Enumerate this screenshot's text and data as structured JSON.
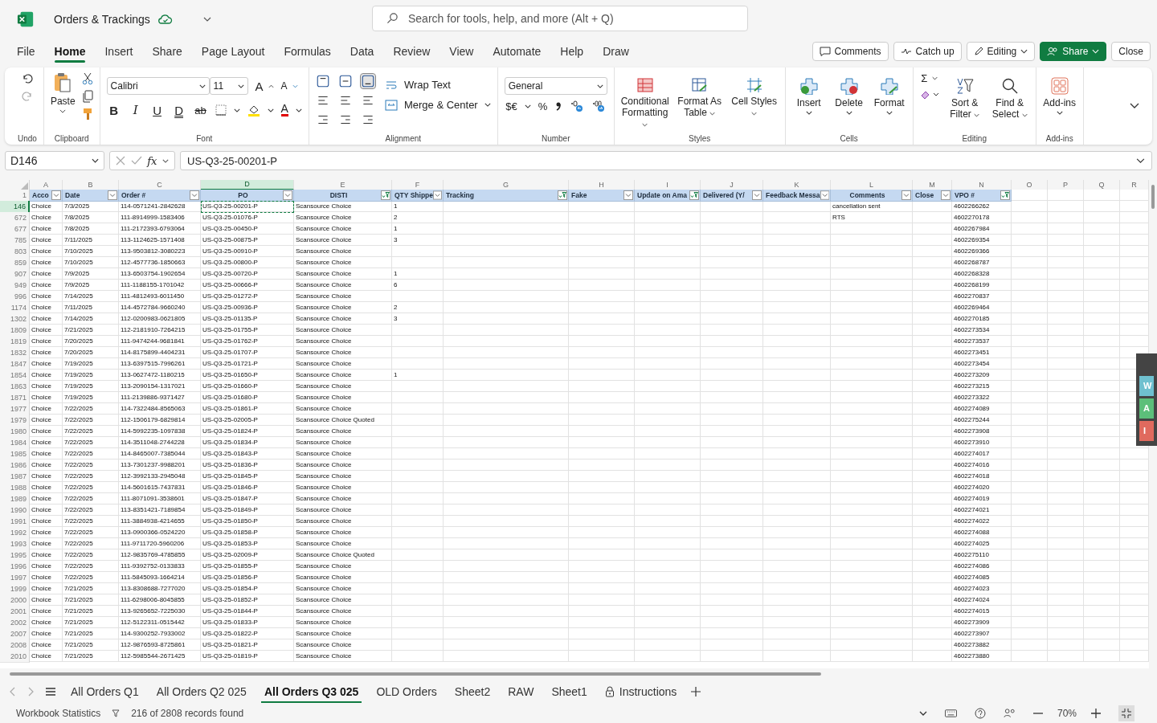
{
  "title_bar": {
    "title": "Orders & Trackings",
    "search": {
      "placeholder": "Search for tools, help, and more (Alt + Q)"
    }
  },
  "menu": [
    {
      "label": "File",
      "selected": false
    },
    {
      "label": "Home",
      "selected": true
    },
    {
      "label": "Insert",
      "selected": false
    },
    {
      "label": "Share",
      "selected": false
    },
    {
      "label": "Page Layout",
      "selected": false
    },
    {
      "label": "Formulas",
      "selected": false
    },
    {
      "label": "Data",
      "selected": false
    },
    {
      "label": "Review",
      "selected": false
    },
    {
      "label": "View",
      "selected": false
    },
    {
      "label": "Automate",
      "selected": false
    },
    {
      "label": "Help",
      "selected": false
    },
    {
      "label": "Draw",
      "selected": false
    }
  ],
  "actions": {
    "comments": "Comments",
    "catch_up": "Catch up",
    "editing": "Editing",
    "share": "Share",
    "close": "Close"
  },
  "ribbon": {
    "undo": {
      "label": "Undo"
    },
    "clipboard": {
      "paste": "Paste",
      "label": "Clipboard"
    },
    "font": {
      "name": "Calibri",
      "size": "11",
      "size_buttons": [
        "A",
        "A"
      ],
      "format_buttons": [
        "B",
        "I",
        "U",
        "D",
        "ab"
      ],
      "color_button": "A",
      "label": "Font"
    },
    "alignment": {
      "wrap": "Wrap Text",
      "merge": "Merge & Center",
      "label": "Alignment"
    },
    "number": {
      "format": "General",
      "currency": "$€",
      "percent": "%",
      "label": "Number"
    },
    "styles": {
      "buttons": [
        "Conditional Formatting",
        "Format As Table",
        "Cell Styles"
      ],
      "label": "Styles"
    },
    "cells": {
      "buttons": [
        "Insert",
        "Delete",
        "Format"
      ],
      "label": "Cells"
    },
    "editing": {
      "sum": "Σ",
      "buttons": [
        "Sort & Filter",
        "Find & Select"
      ],
      "label": "Editing"
    },
    "addins": {
      "buttons": [
        "Add-ins"
      ],
      "label": "Add-ins"
    }
  },
  "formula_bar": {
    "name_box": "D146",
    "fx": "fx",
    "formula": "US-Q3-25-00201-P"
  },
  "table": {
    "header_row": "1",
    "columns": [
      {
        "letter": "A",
        "header": "Acco",
        "filtered": false,
        "selected": false
      },
      {
        "letter": "B",
        "header": "Date",
        "filtered": false,
        "selected": false
      },
      {
        "letter": "C",
        "header": "Order #",
        "filtered": false,
        "selected": false
      },
      {
        "letter": "D",
        "header": "PO",
        "filtered": false,
        "selected": true
      },
      {
        "letter": "E",
        "header": "DISTI",
        "filtered": true,
        "selected": false
      },
      {
        "letter": "F",
        "header": "QTY Shippe",
        "filtered": false,
        "selected": false
      },
      {
        "letter": "G",
        "header": "Tracking",
        "filtered": true,
        "selected": false
      },
      {
        "letter": "H",
        "header": "Fake",
        "filtered": false,
        "selected": false
      },
      {
        "letter": "I",
        "header": "Update on Ama",
        "filtered": true,
        "selected": false
      },
      {
        "letter": "J",
        "header": "Delivered (Y/",
        "filtered": false,
        "selected": false
      },
      {
        "letter": "K",
        "header": "Feedback Messa",
        "filtered": false,
        "selected": false
      },
      {
        "letter": "L",
        "header": "Comments",
        "filtered": false,
        "selected": false
      },
      {
        "letter": "M",
        "header": "Close",
        "filtered": false,
        "selected": false
      },
      {
        "letter": "N",
        "header": "VPO #",
        "filtered": true,
        "selected": false
      },
      {
        "letter": "O",
        "selected": false
      },
      {
        "letter": "P",
        "selected": false
      },
      {
        "letter": "Q",
        "selected": false
      },
      {
        "letter": "R",
        "selected": false
      }
    ],
    "rows": [
      {
        "row": "146",
        "account": "Choice",
        "date": "7/3/2025",
        "order": "114-0571241-2842628",
        "po": "US-Q3-25-00201-P",
        "disti": "Scansource Choice",
        "qty": "1",
        "comments": "cancellation sent",
        "vpo": "4602266262",
        "selected": true
      },
      {
        "row": "672",
        "account": "Choice",
        "date": "7/8/2025",
        "order": "111-8914999-1583406",
        "po": "US-Q3-25-01076-P",
        "disti": "Scansource Choice",
        "qty": "2",
        "comments": "RTS",
        "vpo": "4602270178",
        "selected": false
      },
      {
        "row": "677",
        "account": "Choice",
        "date": "7/8/2025",
        "order": "111-2172393-6793064",
        "po": "US-Q3-25-00450-P",
        "disti": "Scansource Choice",
        "qty": "1",
        "vpo": "4602267984",
        "selected": false
      },
      {
        "row": "785",
        "account": "Choice",
        "date": "7/11/2025",
        "order": "113-1124625-1571408",
        "po": "US-Q3-25-00875-P",
        "disti": "Scansource Choice",
        "qty": "3",
        "vpo": "4602269354",
        "selected": false
      },
      {
        "row": "803",
        "account": "Choice",
        "date": "7/10/2025",
        "order": "113-9503812-3080223",
        "po": "US-Q3-25-00910-P",
        "disti": "Scansource Choice",
        "vpo": "4602269366",
        "selected": false
      },
      {
        "row": "859",
        "account": "Choice",
        "date": "7/10/2025",
        "order": "112-4577736-1850663",
        "po": "US-Q3-25-00800-P",
        "disti": "Scansource Choice",
        "vpo": "4602268787",
        "selected": false
      },
      {
        "row": "907",
        "account": "Choice",
        "date": "7/9/2025",
        "order": "113-6503754-1902654",
        "po": "US-Q3-25-00720-P",
        "disti": "Scansource Choice",
        "qty": "1",
        "vpo": "4602268328",
        "selected": false
      },
      {
        "row": "949",
        "account": "Choice",
        "date": "7/9/2025",
        "order": "111-1188155-1701042",
        "po": "US-Q3-25-00666-P",
        "disti": "Scansource Choice",
        "qty": "6",
        "vpo": "4602268199",
        "selected": false
      },
      {
        "row": "996",
        "account": "Choice",
        "date": "7/14/2025",
        "order": "111-4812493-6011450",
        "po": "US-Q3-25-01272-P",
        "disti": "Scansource Choice",
        "vpo": "4602270837",
        "selected": false
      },
      {
        "row": "1174",
        "account": "Choice",
        "date": "7/11/2025",
        "order": "114-4572784-9660240",
        "po": "US-Q3-25-00936-P",
        "disti": "Scansource Choice",
        "qty": "2",
        "vpo": "4602269464",
        "selected": false
      },
      {
        "row": "1302",
        "account": "Choice",
        "date": "7/14/2025",
        "order": "112-0200983-0621805",
        "po": "US-Q3-25-01135-P",
        "disti": "Scansource Choice",
        "qty": "3",
        "vpo": "4602270185",
        "selected": false
      },
      {
        "row": "1809",
        "account": "Choice",
        "date": "7/21/2025",
        "order": "112-2181910-7264215",
        "po": "US-Q3-25-01755-P",
        "disti": "Scansource Choice",
        "vpo": "4602273534",
        "selected": false
      },
      {
        "row": "1819",
        "account": "Choice",
        "date": "7/20/2025",
        "order": "111-9474244-9681841",
        "po": "US-Q3-25-01762-P",
        "disti": "Scansource Choice",
        "vpo": "4602273537",
        "selected": false
      },
      {
        "row": "1832",
        "account": "Choice",
        "date": "7/20/2025",
        "order": "114-8175899-4404231",
        "po": "US-Q3-25-01707-P",
        "disti": "Scansource Choice",
        "vpo": "4602273451",
        "selected": false
      },
      {
        "row": "1847",
        "account": "Choice",
        "date": "7/19/2025",
        "order": "113-6397515-7996261",
        "po": "US-Q3-25-01721-P",
        "disti": "Scansource Choice",
        "vpo": "4602273454",
        "selected": false
      },
      {
        "row": "1854",
        "account": "Choice",
        "date": "7/19/2025",
        "order": "113-0627472-1180215",
        "po": "US-Q3-25-01650-P",
        "disti": "Scansource Choice",
        "qty": "1",
        "vpo": "4602273209",
        "selected": false
      },
      {
        "row": "1863",
        "account": "Choice",
        "date": "7/19/2025",
        "order": "113-2090154-1317021",
        "po": "US-Q3-25-01660-P",
        "disti": "Scansource Choice",
        "vpo": "4602273215",
        "selected": false
      },
      {
        "row": "1871",
        "account": "Choice",
        "date": "7/19/2025",
        "order": "111-2139886-9371427",
        "po": "US-Q3-25-01680-P",
        "disti": "Scansource Choice",
        "vpo": "4602273322",
        "selected": false
      },
      {
        "row": "1977",
        "account": "Choice",
        "date": "7/22/2025",
        "order": "114-7322484-8565063",
        "po": "US-Q3-25-01861-P",
        "disti": "Scansource Choice",
        "vpo": "4602274089",
        "selected": false
      },
      {
        "row": "1979",
        "account": "Choice",
        "date": "7/22/2025",
        "order": "112-1506179-6829814",
        "po": "US-Q3-25-02005-P",
        "disti": "Scansource Choice Quoted",
        "vpo": "4602275244",
        "selected": false
      },
      {
        "row": "1980",
        "account": "Choice",
        "date": "7/22/2025",
        "order": "114-5992235-1097838",
        "po": "US-Q3-25-01824-P",
        "disti": "Scansource Choice",
        "vpo": "4602273908",
        "selected": false
      },
      {
        "row": "1984",
        "account": "Choice",
        "date": "7/22/2025",
        "order": "114-3511048-2744228",
        "po": "US-Q3-25-01834-P",
        "disti": "Scansource Choice",
        "vpo": "4602273910",
        "selected": false
      },
      {
        "row": "1985",
        "account": "Choice",
        "date": "7/22/2025",
        "order": "114-8465007-7385044",
        "po": "US-Q3-25-01843-P",
        "disti": "Scansource Choice",
        "vpo": "4602274017",
        "selected": false
      },
      {
        "row": "1986",
        "account": "Choice",
        "date": "7/22/2025",
        "order": "113-7301237-9988201",
        "po": "US-Q3-25-01836-P",
        "disti": "Scansource Choice",
        "vpo": "4602274016",
        "selected": false
      },
      {
        "row": "1987",
        "account": "Choice",
        "date": "7/22/2025",
        "order": "112-3992133-2945048",
        "po": "US-Q3-25-01845-P",
        "disti": "Scansource Choice",
        "vpo": "4602274018",
        "selected": false
      },
      {
        "row": "1988",
        "account": "Choice",
        "date": "7/22/2025",
        "order": "114-5601615-7437831",
        "po": "US-Q3-25-01846-P",
        "disti": "Scansource Choice",
        "vpo": "4602274020",
        "selected": false
      },
      {
        "row": "1989",
        "account": "Choice",
        "date": "7/22/2025",
        "order": "111-8071091-3538601",
        "po": "US-Q3-25-01847-P",
        "disti": "Scansource Choice",
        "vpo": "4602274019",
        "selected": false
      },
      {
        "row": "1990",
        "account": "Choice",
        "date": "7/22/2025",
        "order": "113-8351421-7189854",
        "po": "US-Q3-25-01849-P",
        "disti": "Scansource Choice",
        "vpo": "4602274021",
        "selected": false
      },
      {
        "row": "1991",
        "account": "Choice",
        "date": "7/22/2025",
        "order": "111-3884938-4214655",
        "po": "US-Q3-25-01850-P",
        "disti": "Scansource Choice",
        "vpo": "4602274022",
        "selected": false
      },
      {
        "row": "1992",
        "account": "Choice",
        "date": "7/22/2025",
        "order": "113-0900366-0524220",
        "po": "US-Q3-25-01858-P",
        "disti": "Scansource Choice",
        "vpo": "4602274088",
        "selected": false
      },
      {
        "row": "1993",
        "account": "Choice",
        "date": "7/22/2025",
        "order": "111-9711720-5960206",
        "po": "US-Q3-25-01853-P",
        "disti": "Scansource Choice",
        "vpo": "4602274025",
        "selected": false
      },
      {
        "row": "1995",
        "account": "Choice",
        "date": "7/22/2025",
        "order": "112-9835769-4785855",
        "po": "US-Q3-25-02009-P",
        "disti": "Scansource Choice Quoted",
        "vpo": "4602275110",
        "selected": false
      },
      {
        "row": "1996",
        "account": "Choice",
        "date": "7/22/2025",
        "order": "111-9392752-0133833",
        "po": "US-Q3-25-01855-P",
        "disti": "Scansource Choice",
        "vpo": "4602274086",
        "selected": false
      },
      {
        "row": "1997",
        "account": "Choice",
        "date": "7/22/2025",
        "order": "111-5845093-1664214",
        "po": "US-Q3-25-01856-P",
        "disti": "Scansource Choice",
        "vpo": "4602274085",
        "selected": false
      },
      {
        "row": "1999",
        "account": "Choice",
        "date": "7/21/2025",
        "order": "113-8308688-7277020",
        "po": "US-Q3-25-01854-P",
        "disti": "Scansource Choice",
        "vpo": "4602274023",
        "selected": false
      },
      {
        "row": "2000",
        "account": "Choice",
        "date": "7/21/2025",
        "order": "111-6298006-8045855",
        "po": "US-Q3-25-01852-P",
        "disti": "Scansource Choice",
        "vpo": "4602274024",
        "selected": false
      },
      {
        "row": "2001",
        "account": "Choice",
        "date": "7/21/2025",
        "order": "113-9265652-7225030",
        "po": "US-Q3-25-01844-P",
        "disti": "Scansource Choice",
        "vpo": "4602274015",
        "selected": false
      },
      {
        "row": "2002",
        "account": "Choice",
        "date": "7/21/2025",
        "order": "112-5122311-0515442",
        "po": "US-Q3-25-01833-P",
        "disti": "Scansource Choice",
        "vpo": "4602273909",
        "selected": false
      },
      {
        "row": "2007",
        "account": "Choice",
        "date": "7/21/2025",
        "order": "114-9300252-7933002",
        "po": "US-Q3-25-01822-P",
        "disti": "Scansource Choice",
        "vpo": "4602273907",
        "selected": false
      },
      {
        "row": "2008",
        "account": "Choice",
        "date": "7/21/2025",
        "order": "112-9876593-8725861",
        "po": "US-Q3-25-01821-P",
        "disti": "Scansource Choice",
        "vpo": "4602273882",
        "selected": false
      },
      {
        "row": "2010",
        "account": "Choice",
        "date": "7/21/2025",
        "order": "112-5985544-2671425",
        "po": "US-Q3-25-01819-P",
        "disti": "Scansource Choice",
        "vpo": "4602273880",
        "selected": false
      }
    ]
  },
  "side_panel": [
    {
      "label": "W",
      "color": "#6fc0cf"
    },
    {
      "label": "A",
      "color": "#5cbf7a"
    },
    {
      "label": "I",
      "color": "#e06a5e"
    }
  ],
  "sheet_tabs": [
    {
      "label": "All Orders Q1",
      "selected": false,
      "locked": false
    },
    {
      "label": "All Orders Q2 025",
      "selected": false,
      "locked": false
    },
    {
      "label": "All Orders Q3 025",
      "selected": true,
      "locked": false
    },
    {
      "label": "OLD Orders",
      "selected": false,
      "locked": false
    },
    {
      "label": "Sheet2",
      "selected": false,
      "locked": false
    },
    {
      "label": "RAW",
      "selected": false,
      "locked": false
    },
    {
      "label": "Sheet1",
      "selected": false,
      "locked": false
    },
    {
      "label": "Instructions",
      "selected": false,
      "locked": true
    }
  ],
  "status_bar": {
    "statistics": "Workbook Statistics",
    "records": "216 of 2808 records found",
    "zoom": "70%"
  }
}
